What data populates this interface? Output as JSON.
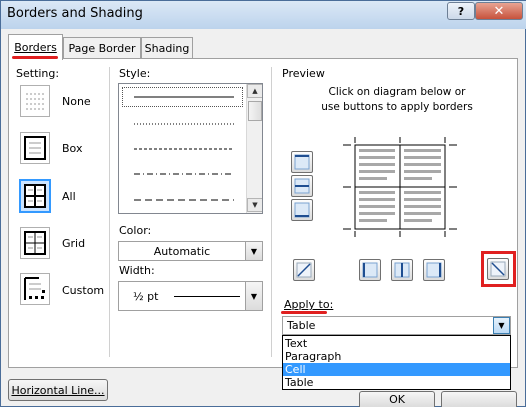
{
  "dialog": {
    "title": "Borders and Shading",
    "help_label": "?",
    "close_label": "✕"
  },
  "tabs": [
    {
      "label": "Borders"
    },
    {
      "label": "Page Border"
    },
    {
      "label": "Shading"
    }
  ],
  "setting": {
    "label": "Setting:",
    "options": [
      {
        "label": "None",
        "selected": false
      },
      {
        "label": "Box",
        "selected": false
      },
      {
        "label": "All",
        "selected": true
      },
      {
        "label": "Grid",
        "selected": false
      },
      {
        "label": "Custom",
        "selected": false
      }
    ]
  },
  "style": {
    "label": "Style:",
    "line_styles": [
      "solid",
      "dotted",
      "dashed",
      "dash-dot",
      "long-dash"
    ]
  },
  "color": {
    "label": "Color:",
    "value": "Automatic"
  },
  "width": {
    "label": "Width:",
    "value": "½ pt"
  },
  "preview": {
    "label": "Preview",
    "instructions": "Click on diagram below or use buttons to apply borders"
  },
  "apply_to": {
    "label": "Apply to:",
    "value": "Table",
    "options": [
      "Text",
      "Paragraph",
      "Cell",
      "Table"
    ],
    "selected_option": "Cell"
  },
  "buttons": {
    "horizontal_line": "Horizontal Line...",
    "ok": "OK"
  },
  "colors": {
    "annotation_red": "#e02020",
    "selection_blue": "#3399ff"
  }
}
